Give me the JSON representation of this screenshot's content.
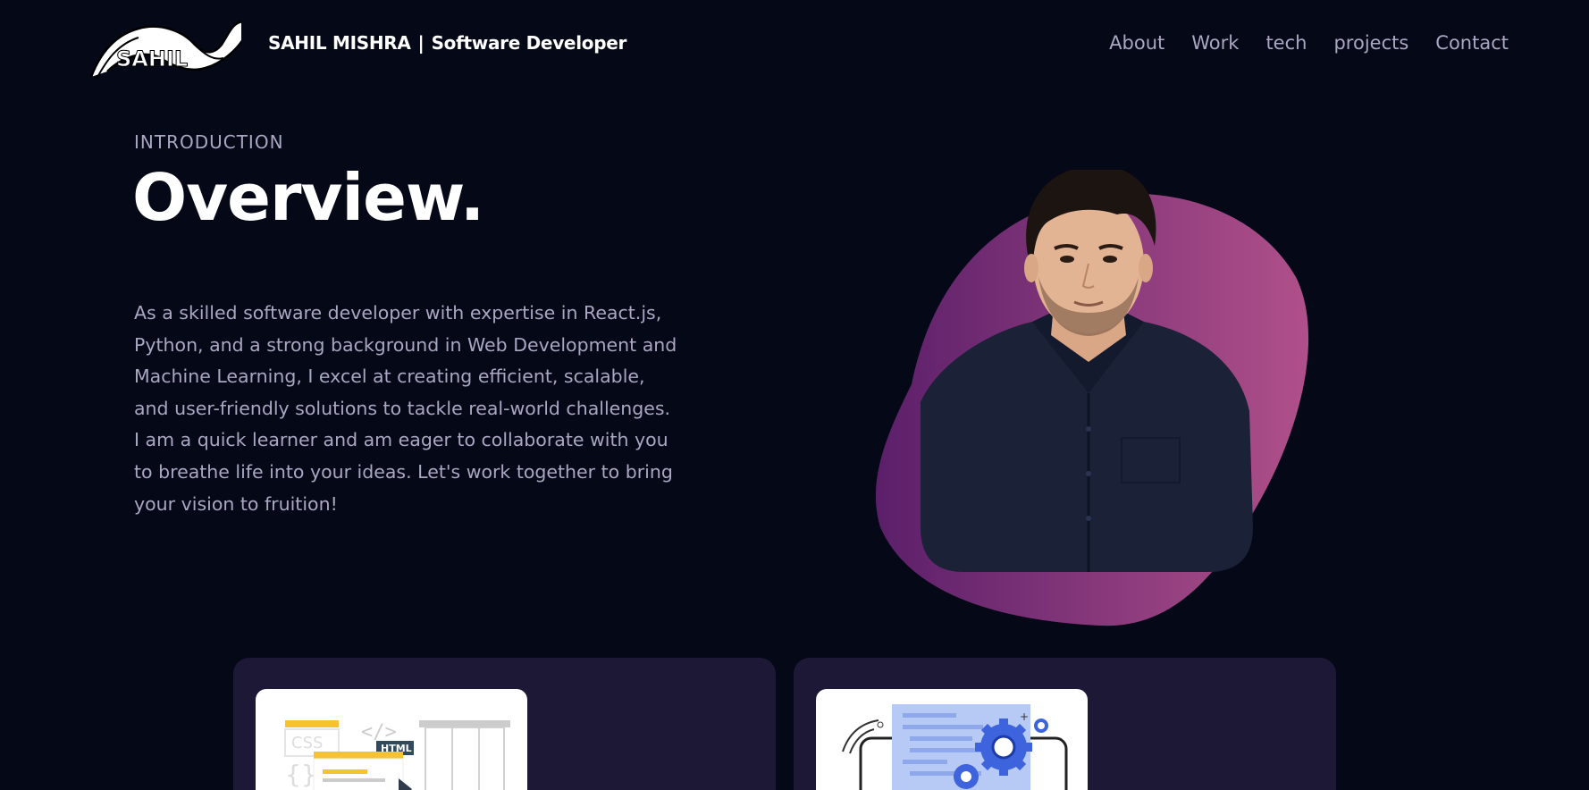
{
  "header": {
    "logo_text": "SAHIL",
    "brand_name": "SAHIL MISHRA",
    "separator": "|",
    "brand_role": "Software Developer",
    "nav": [
      "About",
      "Work",
      "tech",
      "projects",
      "Contact"
    ]
  },
  "intro": {
    "eyebrow": "INTRODUCTION",
    "title": "Overview.",
    "bio": "As a skilled software developer with expertise in React.js, Python, and a strong background in Web Development and Machine Learning, I excel at creating efficient, scalable, and user-friendly solutions to tackle real-world challenges. I am a quick learner and am eager to collaborate with you to breathe life into your ideas. Let's work together to bring your vision to fruition!"
  },
  "cards": [
    {
      "illustration": "web-development-illustration",
      "labels": [
        "CSS",
        "HTML"
      ]
    },
    {
      "illustration": "gears-code-illustration"
    }
  ],
  "colors": {
    "background": "#050816",
    "secondary_text": "#aaa6c3",
    "card_bg": "#1d1836",
    "blob_start": "#5b1f6a",
    "blob_end": "#b0508a"
  }
}
